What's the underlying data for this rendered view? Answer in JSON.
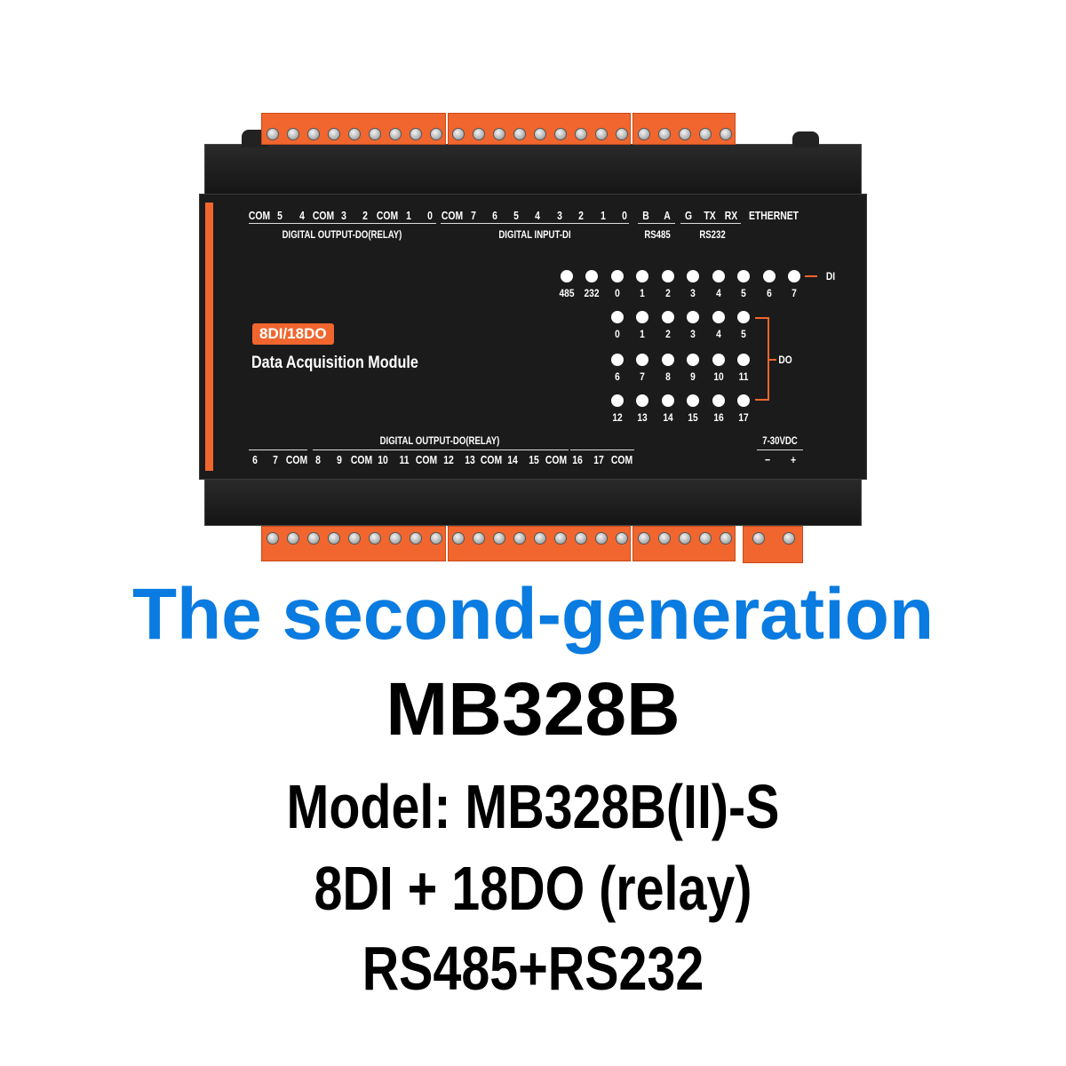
{
  "device": {
    "top_labels": [
      "COM",
      "5",
      "4",
      "COM",
      "3",
      "2",
      "COM",
      "1",
      "0",
      "COM",
      "7",
      "6",
      "5",
      "4",
      "3",
      "2",
      "1",
      "0",
      "B",
      "A",
      "G",
      "TX",
      "RX",
      "ETHERNET"
    ],
    "top_groups": [
      "DIGITAL OUTPUT-DO(RELAY)",
      "DIGITAL INPUT-DI",
      "RS485",
      "RS232"
    ],
    "bottom_group": "DIGITAL OUTPUT-DO(RELAY)",
    "bottom_labels": [
      "6",
      "7",
      "COM",
      "8",
      "9",
      "COM",
      "10",
      "11",
      "COM",
      "12",
      "13",
      "COM",
      "14",
      "15",
      "COM",
      "16",
      "17",
      "COM"
    ],
    "power_label": "7-30VDC",
    "power_minus": "−",
    "power_plus": "+",
    "badge": "8DI/18DO",
    "name": "Data Acquisition Module",
    "di_leds": [
      "485",
      "232",
      "0",
      "1",
      "2",
      "3",
      "4",
      "5",
      "6",
      "7"
    ],
    "di_tag": "DI",
    "do_leds": [
      [
        "0",
        "1",
        "2",
        "3",
        "4",
        "5"
      ],
      [
        "6",
        "7",
        "8",
        "9",
        "10",
        "11"
      ],
      [
        "12",
        "13",
        "14",
        "15",
        "16",
        "17"
      ]
    ],
    "do_tag": "DO",
    "accent": "#f0662e"
  },
  "headline": "The second-generation",
  "headline_color": "#0a7be0",
  "model_title": "MB328B",
  "lines": [
    "Model: MB328B(II)-S",
    "8DI + 18DO (relay)",
    "RS485+RS232"
  ]
}
